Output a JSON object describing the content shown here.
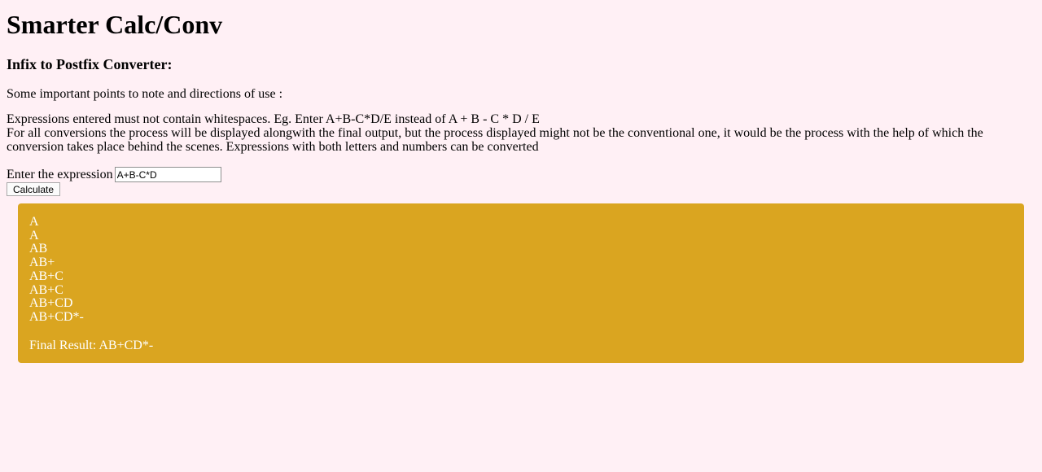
{
  "page": {
    "title": "Smarter Calc/Conv",
    "subtitle": "Infix to Postfix Converter:",
    "intro": "Some important points to note and directions of use :",
    "direction_1": "Expressions entered must not contain whitespaces. Eg. Enter A+B-C*D/E instead of A + B - C * D / E",
    "direction_2": "For all conversions the process will be displayed alongwith the final output, but the process displayed might not be the conventional one, it would be the process with the help of which the conversion takes place behind the scenes. Expressions with both letters and numbers can be converted"
  },
  "form": {
    "label": "Enter the expression",
    "input_value": "A+B-C*D",
    "button_label": "Calculate"
  },
  "result": {
    "steps": [
      "A",
      "A",
      "AB",
      "AB+",
      "AB+C",
      "AB+C",
      "AB+CD",
      "AB+CD*-"
    ],
    "final": "Final Result: AB+CD*-"
  },
  "colors": {
    "background": "#fff0f5",
    "result_bg": "#daa520",
    "result_text": "#ffffff"
  }
}
